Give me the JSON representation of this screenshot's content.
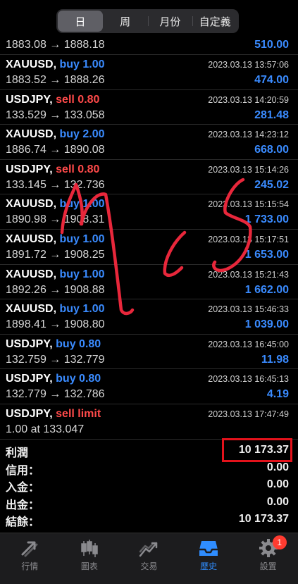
{
  "segments": [
    "日",
    "周",
    "月份",
    "自定義"
  ],
  "active_segment": 0,
  "trades": [
    {
      "prices": "1883.08 → 1888.18",
      "profit": "510.00"
    },
    {
      "symbol": "XAUUSD,",
      "action": "buy 1.00",
      "action_type": "buy",
      "time": "2023.03.13 13:57:06",
      "prices": "1883.52 → 1888.26",
      "profit": "474.00"
    },
    {
      "symbol": "USDJPY,",
      "action": "sell 0.80",
      "action_type": "sell",
      "time": "2023.03.13 14:20:59",
      "prices": "133.529 → 133.058",
      "profit": "281.48"
    },
    {
      "symbol": "XAUUSD,",
      "action": "buy 2.00",
      "action_type": "buy",
      "time": "2023.03.13 14:23:12",
      "prices": "1886.74 → 1890.08",
      "profit": "668.00"
    },
    {
      "symbol": "USDJPY,",
      "action": "sell 0.80",
      "action_type": "sell",
      "time": "2023.03.13 15:14:26",
      "prices": "133.145 → 132.736",
      "profit": "245.02"
    },
    {
      "symbol": "XAUUSD,",
      "action": "buy 1.00",
      "action_type": "buy",
      "time": "2023.03.13 15:15:54",
      "prices": "1890.98 → 1908.31",
      "profit": "1 733.00"
    },
    {
      "symbol": "XAUUSD,",
      "action": "buy 1.00",
      "action_type": "buy",
      "time": "2023.03.13 15:17:51",
      "prices": "1891.72 → 1908.25",
      "profit": "1 653.00"
    },
    {
      "symbol": "XAUUSD,",
      "action": "buy 1.00",
      "action_type": "buy",
      "time": "2023.03.13 15:21:43",
      "prices": "1892.26 → 1908.88",
      "profit": "1 662.00"
    },
    {
      "symbol": "XAUUSD,",
      "action": "buy 1.00",
      "action_type": "buy",
      "time": "2023.03.13 15:46:33",
      "prices": "1898.41 → 1908.80",
      "profit": "1 039.00"
    },
    {
      "symbol": "USDJPY,",
      "action": "buy 0.80",
      "action_type": "buy",
      "time": "2023.03.13 16:45:00",
      "prices": "132.759 → 132.779",
      "profit": "11.98"
    },
    {
      "symbol": "USDJPY,",
      "action": "buy 0.80",
      "action_type": "buy",
      "time": "2023.03.13 16:45:13",
      "prices": "132.779 → 132.786",
      "profit": "4.19"
    },
    {
      "symbol": "USDJPY,",
      "action": "sell limit",
      "action_type": "sell",
      "time": "2023.03.13 17:47:49",
      "prices": "1.00 at 133.047",
      "profit": ""
    }
  ],
  "summary": [
    {
      "label": "利潤",
      "value": "10 173.37",
      "highlighted": true
    },
    {
      "label": "信用：",
      "value": "0.00"
    },
    {
      "label": "入金：",
      "value": "0.00"
    },
    {
      "label": "出金：",
      "value": "0.00"
    },
    {
      "label": "結餘：",
      "value": "10 173.37"
    }
  ],
  "tabs": [
    {
      "label": "行情",
      "icon": "quotes-arrows-icon"
    },
    {
      "label": "圖表",
      "icon": "candlestick-chart-icon"
    },
    {
      "label": "交易",
      "icon": "trade-chart-icon"
    },
    {
      "label": "歷史",
      "icon": "history-inbox-icon"
    },
    {
      "label": "設置",
      "icon": "settings-gear-icon",
      "badge": "1"
    }
  ],
  "active_tab": 3,
  "colors": {
    "buy": "#3a8bff",
    "sell": "#ff4a4a",
    "profit": "#3a8bff",
    "highlight_box": "#e3121b",
    "scribble": "#e8273b",
    "active_tab": "#2f8dff"
  }
}
